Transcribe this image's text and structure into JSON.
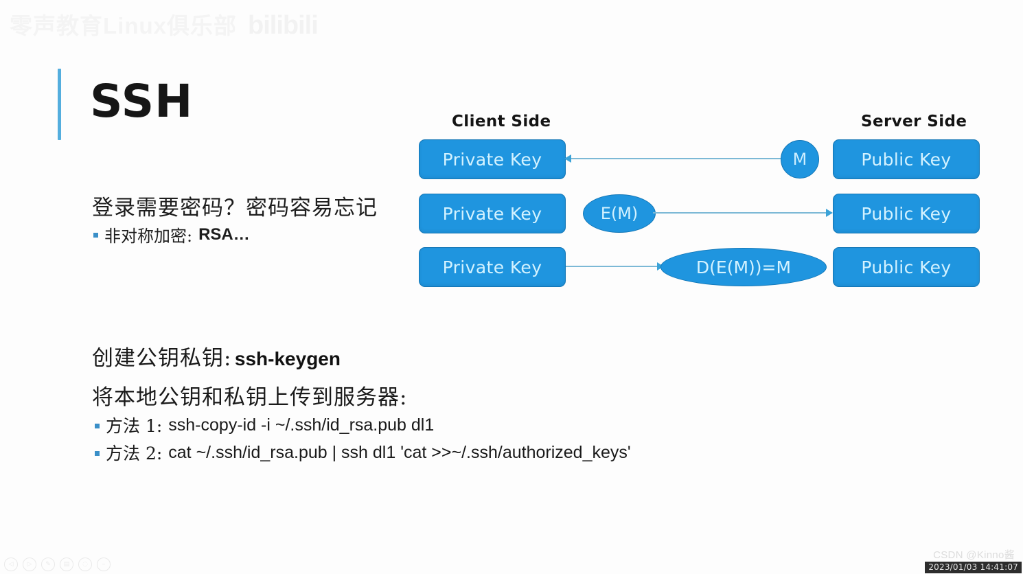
{
  "slide": {
    "title": "SSH",
    "accent_color": "#54aede",
    "box_color": "#1f95df",
    "box_border_color": "#1276b6",
    "box_text_color": "#d3f2ff",
    "connector_color": "#7cb9d6"
  },
  "watermark": {
    "brand_text": "零声教育Linux俱乐部",
    "logo_text": "bilibili",
    "csdn": "CSDN @Kinno酱",
    "timestamp": "2023/01/03 14:41:07"
  },
  "left_text": {
    "lead": "登录需要密码？密码容易忘记",
    "bullet_cn": "非对称加密:",
    "bullet_en": "RSA…",
    "create_keys_cn": "创建公钥私钥:",
    "create_keys_cmd": "ssh-keygen",
    "upload_cn": "将本地公钥和私钥上传到服务器:",
    "methods": [
      {
        "label": "方法 1:",
        "command": "ssh-copy-id -i ~/.ssh/id_rsa.pub dl1"
      },
      {
        "label": "方法 2:",
        "command": "cat ~/.ssh/id_rsa.pub | ssh dl1 'cat >>~/.ssh/authorized_keys'"
      }
    ]
  },
  "diagram": {
    "client_label": "Client Side",
    "server_label": "Server Side",
    "rows": [
      {
        "left": "Private Key",
        "right": "Public Key"
      },
      {
        "left": "Private Key",
        "right": "Public Key"
      },
      {
        "left": "Private Key",
        "right": "Public Key"
      }
    ],
    "node_m": "M",
    "node_em": "E(M)",
    "node_dem": "D(E(M))=M"
  },
  "toolbar": {
    "buttons": [
      {
        "name": "previous",
        "glyph": "◁"
      },
      {
        "name": "play",
        "glyph": "▷"
      },
      {
        "name": "edit",
        "glyph": "✎"
      },
      {
        "name": "save",
        "glyph": "▤"
      },
      {
        "name": "zoom",
        "glyph": "◌"
      },
      {
        "name": "minimize",
        "glyph": "–"
      }
    ]
  }
}
